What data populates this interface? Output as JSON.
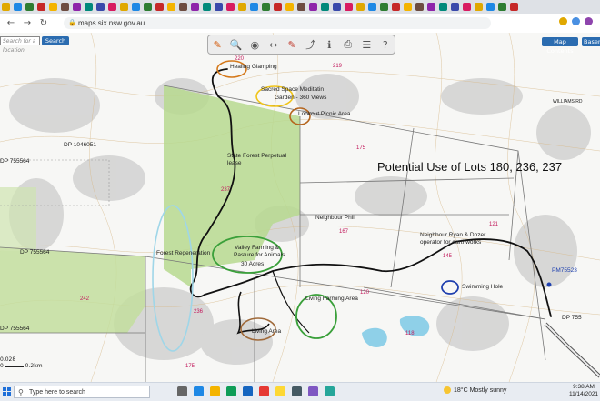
{
  "browser": {
    "url": "maps.six.nsw.gov.au",
    "colors": {
      "chrome_bg": "#dee1e6",
      "accent": "#2b6cb0"
    }
  },
  "map": {
    "search_placeholder": "Search for a location",
    "search_button": "Search",
    "map_contents_button": "Map Contents",
    "basemap_button": "Basemaps",
    "toolbar_icons": [
      "pencil-icon",
      "zoom-icon",
      "identify-icon",
      "measure-icon",
      "draw-icon",
      "share-icon",
      "info-icon",
      "print-icon",
      "layers-icon",
      "help-icon"
    ],
    "overlay_title": "Potential Use of Lots 180, 236, 237",
    "annotations": {
      "healing": "Healing Glamping",
      "sacred": "Sacred Space Meditatin",
      "garden": "Garden - 360 Views",
      "lookout": "Lookout Picnic Area",
      "state_forest_1": "State Forest Perpetual",
      "state_forest_2": "lease",
      "neighbour_phill": "Neighbour Phill",
      "ryan_1": "Neighbour Ryan & Dozer",
      "ryan_2": "operator for earthworks",
      "forest_regen": "Forest Regeneration",
      "valley_1": "Valley Farming &",
      "valley_2": "Pasture for Animals",
      "acres": "30 Acres",
      "living_farming": "Living Farming Area",
      "swimming": "Swimming Hole",
      "living_area": "Living Area"
    },
    "parcels": {
      "dp1046051": "DP 1046051",
      "dp755564_top": "DP 755564",
      "dp755564_mid": "DP 755564",
      "dp755564_bottom": "DP 755564",
      "pm75523": "PM75523",
      "dp755_right": "DP 755",
      "williams_rd": "WILLIAMS RD",
      "lot_220": "220",
      "lot_219": "219",
      "lot_175": "175",
      "lot_237": "237",
      "lot_167": "167",
      "lot_121": "121",
      "lot_242": "242",
      "lot_236": "236",
      "lot_118": "118",
      "lot_175b": "175",
      "lot_120": "120",
      "lot_145": "145"
    },
    "scale": {
      "a": "0.028",
      "b": "0",
      "c": "0.2km"
    }
  },
  "taskbar": {
    "search_placeholder": "Type here to search",
    "weather": "18°C  Mostly sunny",
    "time": "9:38 AM",
    "date": "11/14/2021"
  }
}
